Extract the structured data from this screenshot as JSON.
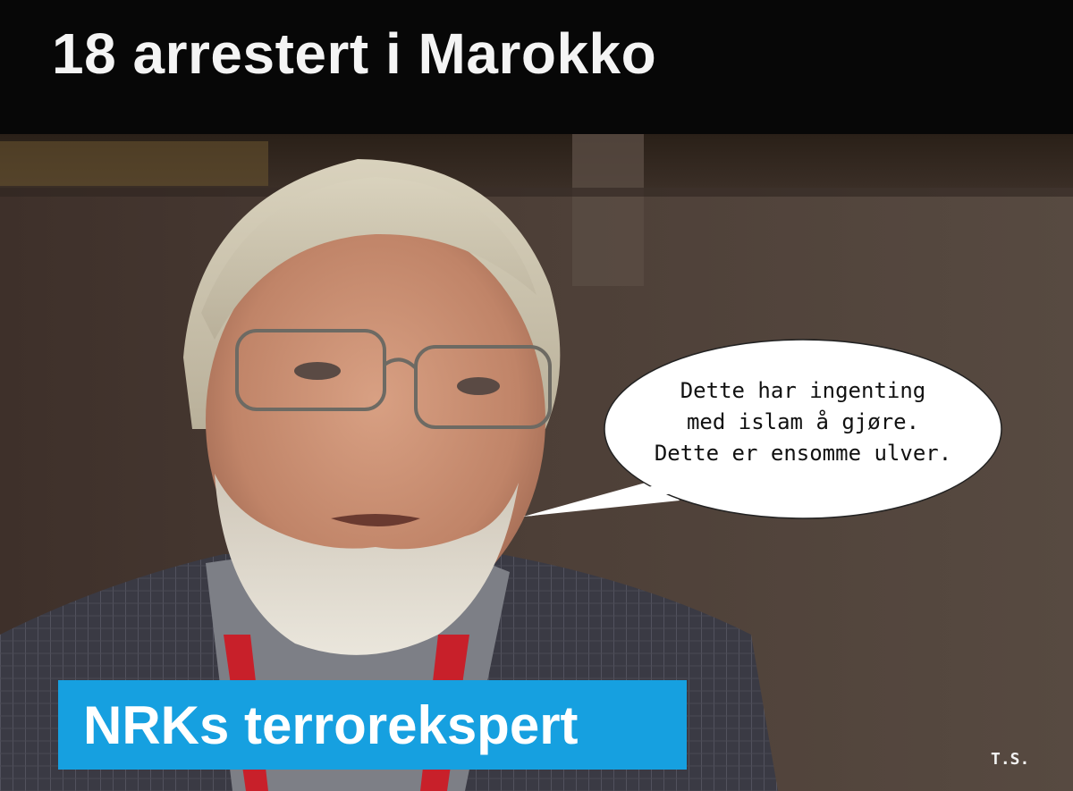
{
  "headline": "18 arrestert i Marokko",
  "speech_bubble": {
    "lines": [
      "Dette har ingenting",
      "med islam å gjøre.",
      "Dette er ensomme ulver."
    ]
  },
  "caption": "NRKs terrorekspert",
  "signature": "T.S.",
  "colors": {
    "title_band": "#070707",
    "caption_background": "#16a0e0",
    "caption_text": "#ffffff",
    "background_wall": "#4a3d35"
  }
}
